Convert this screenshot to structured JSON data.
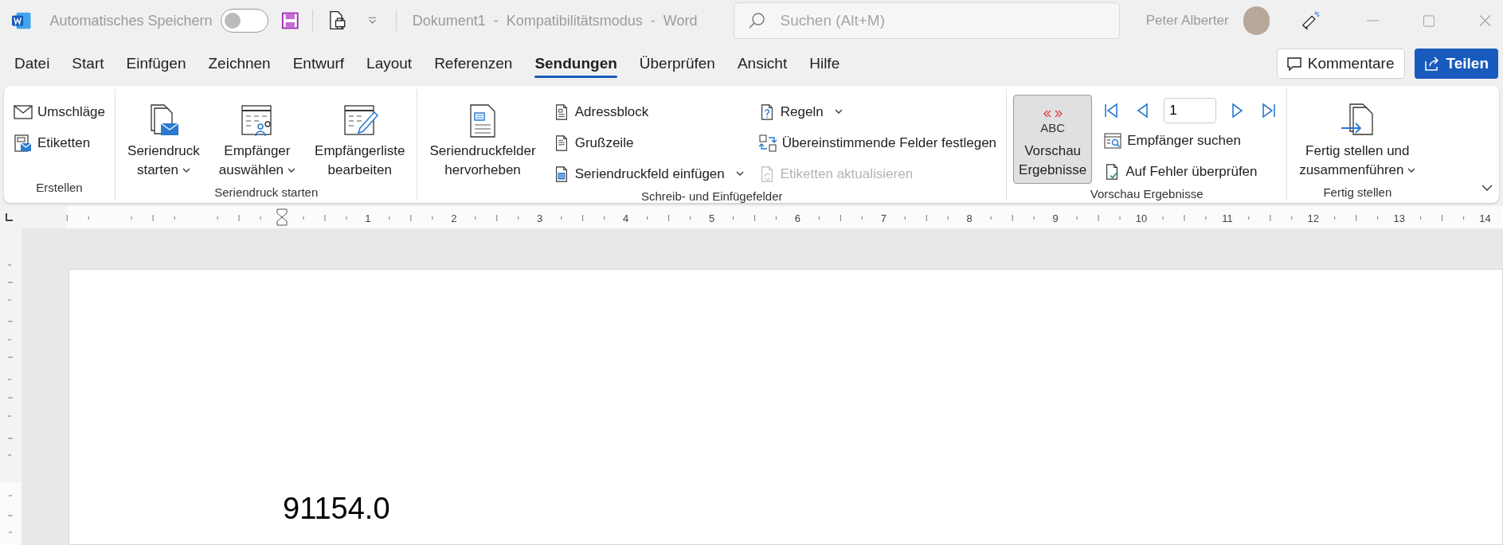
{
  "title_bar": {
    "autosave": {
      "label": "Automatisches Speichern",
      "on": false
    },
    "document_title": "Dokument1  -  Kompatibilitätsmodus  -  Word",
    "search": {
      "placeholder": "Suchen (Alt+M)"
    },
    "user_name": "Peter Alberter"
  },
  "menu_tabs": [
    {
      "label": "Datei",
      "selected": false
    },
    {
      "label": "Start",
      "selected": false
    },
    {
      "label": "Einfügen",
      "selected": false
    },
    {
      "label": "Zeichnen",
      "selected": false
    },
    {
      "label": "Entwurf",
      "selected": false
    },
    {
      "label": "Layout",
      "selected": false
    },
    {
      "label": "Referenzen",
      "selected": false
    },
    {
      "label": "Sendungen",
      "selected": true
    },
    {
      "label": "Überprüfen",
      "selected": false
    },
    {
      "label": "Ansicht",
      "selected": false
    },
    {
      "label": "Hilfe",
      "selected": false
    }
  ],
  "actions": [
    "Kommentare",
    "Teilen"
  ],
  "ribbon": {
    "groups": [
      {
        "label": "Erstellen",
        "controls": [
          {
            "kind": "stack",
            "items": [
              {
                "kind": "button",
                "label": "Umschläge",
                "dropdown": false,
                "disabled": false
              },
              {
                "kind": "button",
                "label": "Etiketten",
                "dropdown": false,
                "disabled": false
              }
            ]
          }
        ]
      },
      {
        "label": "Seriendruck starten",
        "controls": [
          {
            "kind": "large",
            "lines": [
              "Seriendruck",
              "starten"
            ],
            "dropdown": true,
            "pressed": false
          },
          {
            "kind": "large",
            "lines": [
              "Empfänger",
              "auswählen"
            ],
            "dropdown": true,
            "pressed": false
          },
          {
            "kind": "large",
            "lines": [
              "Empfängerliste",
              "bearbeiten"
            ],
            "dropdown": false,
            "pressed": false
          }
        ]
      },
      {
        "label": "Schreib- und Einfügefelder",
        "controls": [
          {
            "kind": "large",
            "lines": [
              "Seriendruckfelder",
              "hervorheben"
            ],
            "dropdown": false,
            "pressed": false
          },
          {
            "kind": "stack",
            "items": [
              {
                "kind": "button",
                "label": "Adressblock",
                "dropdown": false,
                "disabled": false
              },
              {
                "kind": "button",
                "label": "Grußzeile",
                "dropdown": false,
                "disabled": false
              },
              {
                "kind": "button",
                "label": "Seriendruckfeld einfügen",
                "dropdown": true,
                "disabled": false
              }
            ]
          },
          {
            "kind": "stack",
            "items": [
              {
                "kind": "button",
                "label": "Regeln",
                "dropdown": true,
                "disabled": false
              },
              {
                "kind": "button",
                "label": "Übereinstimmende Felder festlegen",
                "dropdown": false,
                "disabled": false
              },
              {
                "kind": "button",
                "label": "Etiketten aktualisieren",
                "dropdown": false,
                "disabled": true
              }
            ]
          }
        ]
      },
      {
        "label": "Vorschau Ergebnisse",
        "controls": [
          {
            "kind": "large",
            "icon_text": "ABC",
            "lines": [
              "Vorschau",
              "Ergebnisse"
            ],
            "dropdown": false,
            "pressed": true
          },
          {
            "kind": "stack",
            "items": [
              {
                "kind": "record_nav",
                "value": "1"
              },
              {
                "kind": "button",
                "label": "Empfänger suchen",
                "dropdown": false,
                "disabled": false
              },
              {
                "kind": "button",
                "label": "Auf Fehler überprüfen",
                "dropdown": false,
                "disabled": false
              }
            ]
          }
        ]
      },
      {
        "label": "Fertig stellen",
        "controls": [
          {
            "kind": "large",
            "lines": [
              "Fertig stellen und",
              "zusammenführen"
            ],
            "dropdown": true,
            "pressed": false
          }
        ]
      }
    ]
  },
  "ruler": {
    "numbers": [
      "1",
      "2",
      "3",
      "4",
      "5",
      "6",
      "7",
      "8",
      "9",
      "10",
      "11",
      "12",
      "13",
      "14"
    ]
  },
  "document": {
    "text": "91154.0"
  }
}
